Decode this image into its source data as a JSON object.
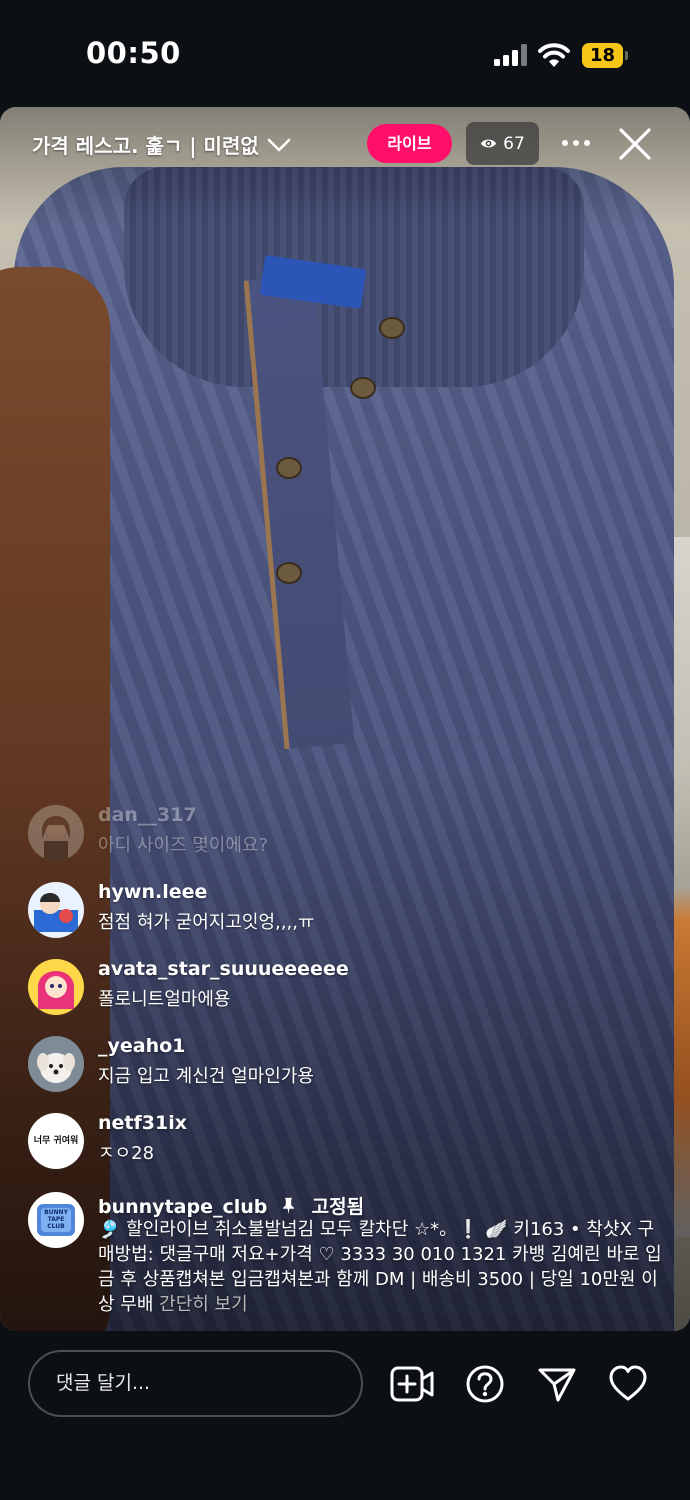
{
  "status_bar": {
    "time": "00:50",
    "battery_level": "18"
  },
  "live": {
    "title": "가격 레스고. 훑ㄱ | 미련없",
    "live_label": "라이브",
    "viewer_count": "67",
    "accent_color": "#ff0f6a"
  },
  "comments": [
    {
      "user": "dan__317",
      "text": "아디 사이즈 몇이에요?",
      "avatar": "avatar-girl-icon"
    },
    {
      "user": "hywn.leee",
      "text": "점점 혀가 굳어지고잇엉,,,,ㅠ",
      "avatar": "avatar-cartoon-icon"
    },
    {
      "user": "avata_star_suuueeeeee",
      "text": "폴로니트얼마에용",
      "avatar": "avatar-doll-icon"
    },
    {
      "user": "_yeaho1",
      "text": "지금 입고 계신건 얼마인가용",
      "avatar": "avatar-puppy-icon"
    },
    {
      "user": "netf31ix",
      "text": "ㅈㅇ28",
      "avatar_text": "너무 귀여워"
    }
  ],
  "pinned_comment": {
    "user": "bunnytape_club",
    "pin_label": "고정됨",
    "avatar_text": "BUNNY TAPE CLUB",
    "text": "🎐 할인라이브 취소불발넘김 모두 칼차단 ☆*。❕ 🪽 키163 • 착샷X 구매방법: 댓글구매 저요+가격 ♡ 3333 30 010 1321 카뱅 김예린 바로 입금 후 상품캡쳐본 입금캡쳐본과 함께 DM | 배송비 3500 | 당일 10만원 이상 무배",
    "see_more": "간단히 보기"
  },
  "bottom_bar": {
    "comment_placeholder": "댓글 달기...",
    "icons": [
      "add-video-icon",
      "question-icon",
      "send-icon",
      "heart-icon"
    ]
  }
}
